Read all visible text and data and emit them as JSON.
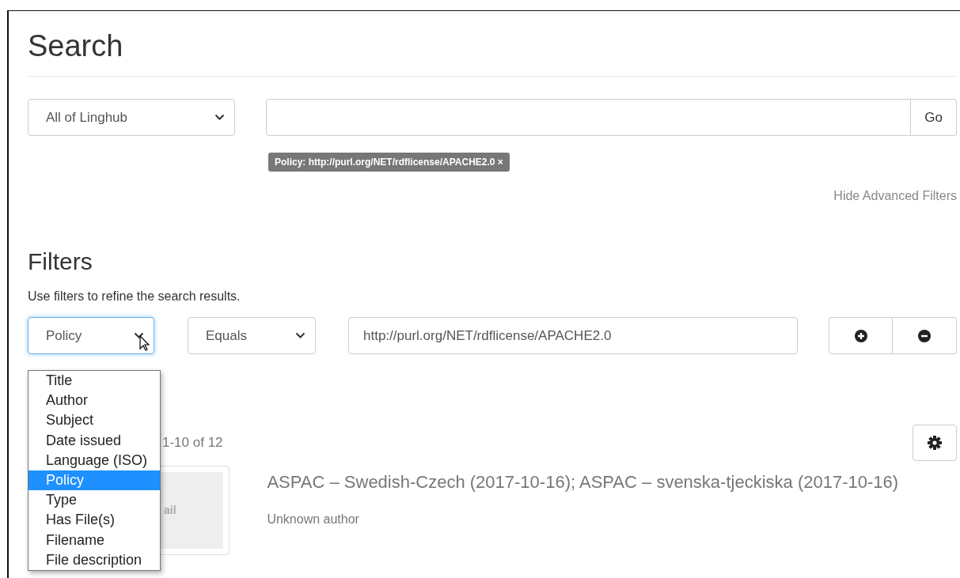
{
  "heading": "Search",
  "scope_select": {
    "value": "All of Linghub"
  },
  "search": {
    "button": "Go"
  },
  "active_filters": [
    {
      "label": "Policy: http://purl.org/NET/rdflicense/APACHE2.0",
      "remove": "×"
    }
  ],
  "advanced_toggle": "Hide Advanced Filters",
  "filters": {
    "title": "Filters",
    "hint": "Use filters to refine the search results.",
    "field": {
      "value": "Policy",
      "focused": true,
      "expanded": true,
      "options": [
        {
          "label": "Title",
          "selected": false
        },
        {
          "label": "Author",
          "selected": false
        },
        {
          "label": "Subject",
          "selected": false
        },
        {
          "label": "Date issued",
          "selected": false
        },
        {
          "label": "Language (ISO)",
          "selected": false
        },
        {
          "label": "Policy",
          "selected": true
        },
        {
          "label": "Type",
          "selected": false
        },
        {
          "label": "Has File(s)",
          "selected": false
        },
        {
          "label": "Filename",
          "selected": false
        },
        {
          "label": "File description",
          "selected": false
        }
      ]
    },
    "operator": {
      "value": "Equals"
    },
    "value": "http://purl.org/NET/rdflicense/APACHE2.0"
  },
  "results": {
    "count": "1-10 of 12",
    "items": [
      {
        "thumbnail_text": "ail",
        "title": "ASPAC – Swedish-Czech (2017-10-16); ASPAC – svenska-tjeckiska (2017-10-16)",
        "author": "Unknown author"
      }
    ]
  }
}
